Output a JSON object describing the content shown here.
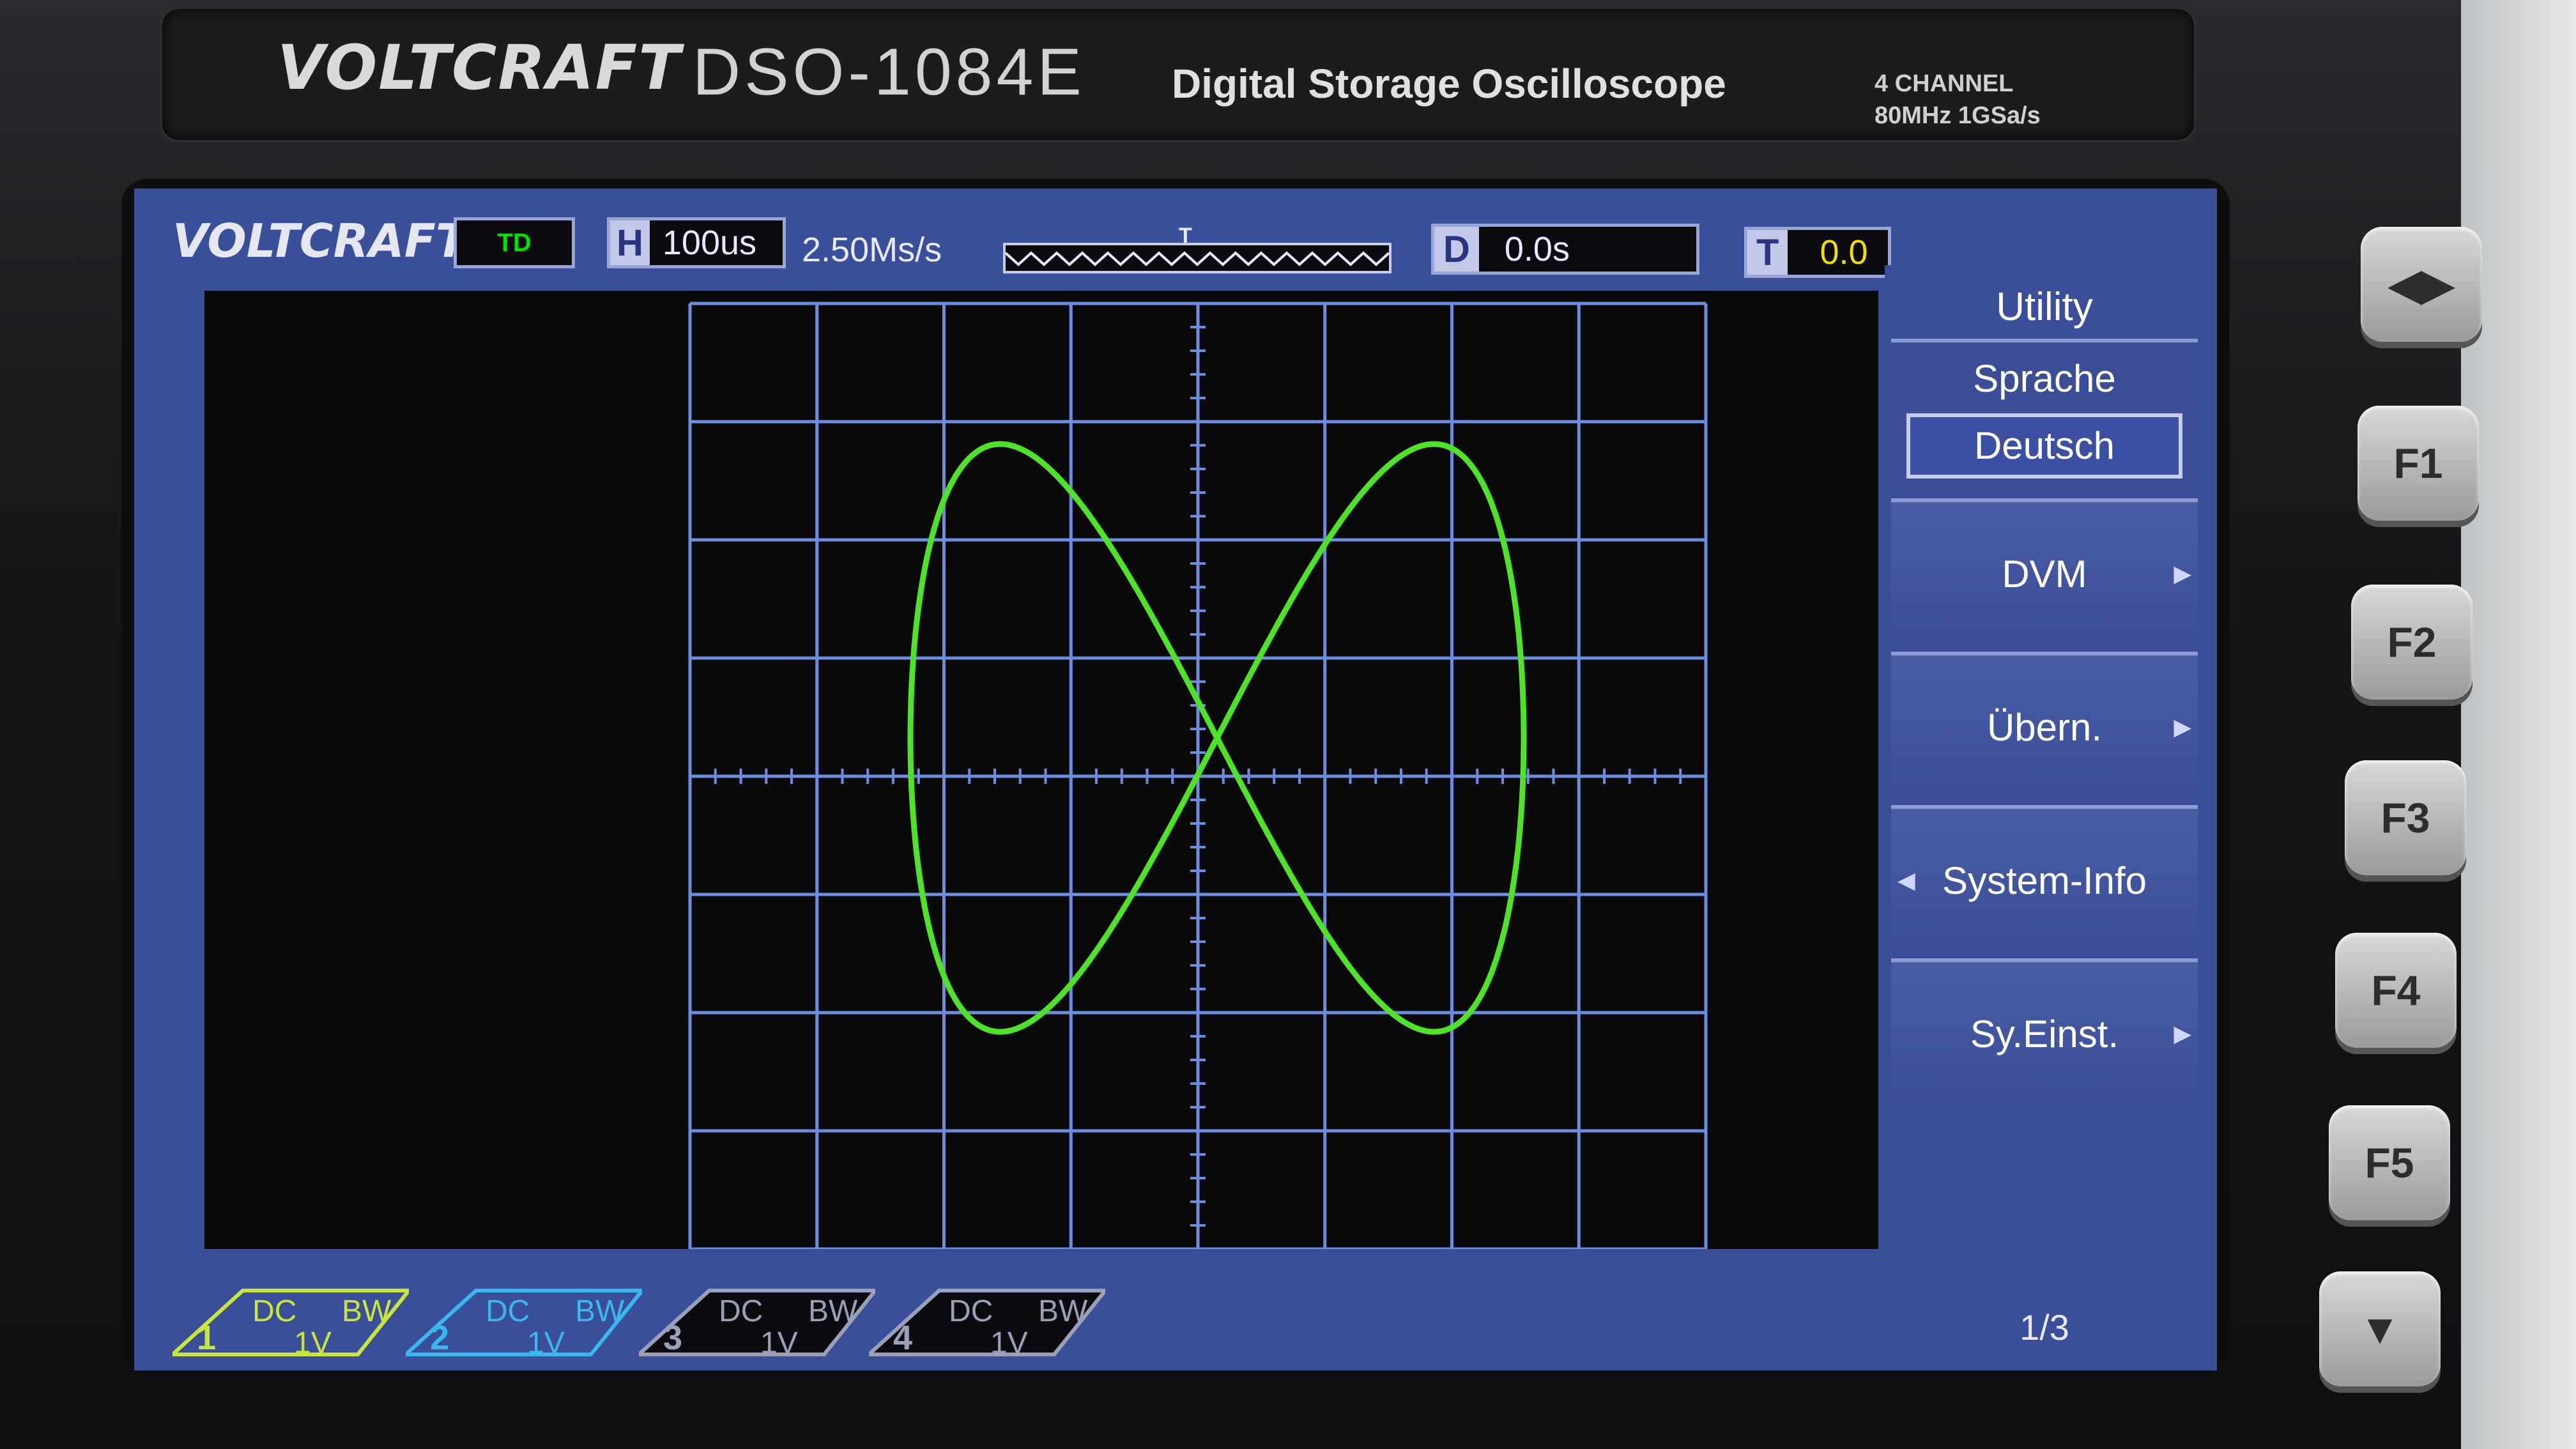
{
  "device": {
    "brand": "VOLTCRAFT",
    "model": "DSO-1084E",
    "description": "Digital Storage Oscilloscope",
    "spec_line1": "4 CHANNEL",
    "spec_line2": "80MHz 1GSa/s"
  },
  "status_bar": {
    "logo": "VOLTCRAFT.",
    "trigger_state": "TD",
    "h_label": "H",
    "timebase": "100us",
    "sample_rate": "2.50Ms/s",
    "trigger_marker": "T",
    "d_label": "D",
    "delay": "0.0s",
    "t_label": "T",
    "trigger_level": "0.0"
  },
  "menu": {
    "title": "Utility",
    "items": [
      {
        "label": "Sprache",
        "value": "Deutsch"
      },
      {
        "label": "DVM"
      },
      {
        "label": "Übern."
      },
      {
        "label": "System-Info"
      },
      {
        "label": "Sy.Einst."
      }
    ],
    "page": "1/3"
  },
  "channels": [
    {
      "num": "1",
      "coupling": "DC",
      "bw": "BW",
      "scale": "1V",
      "color": "#c8e63a"
    },
    {
      "num": "2",
      "coupling": "DC",
      "bw": "BW",
      "scale": "1V",
      "color": "#3ab8ee"
    },
    {
      "num": "3",
      "coupling": "DC",
      "bw": "BW",
      "scale": "1V",
      "color": "#9aa0b8"
    },
    {
      "num": "4",
      "coupling": "DC",
      "bw": "BW",
      "scale": "1V",
      "color": "#9aa0b8"
    }
  ],
  "buttons": [
    "F1",
    "F2",
    "F3",
    "F4",
    "F5"
  ],
  "trace_color": "#4fe22a",
  "grid_color": "#6d8de0"
}
